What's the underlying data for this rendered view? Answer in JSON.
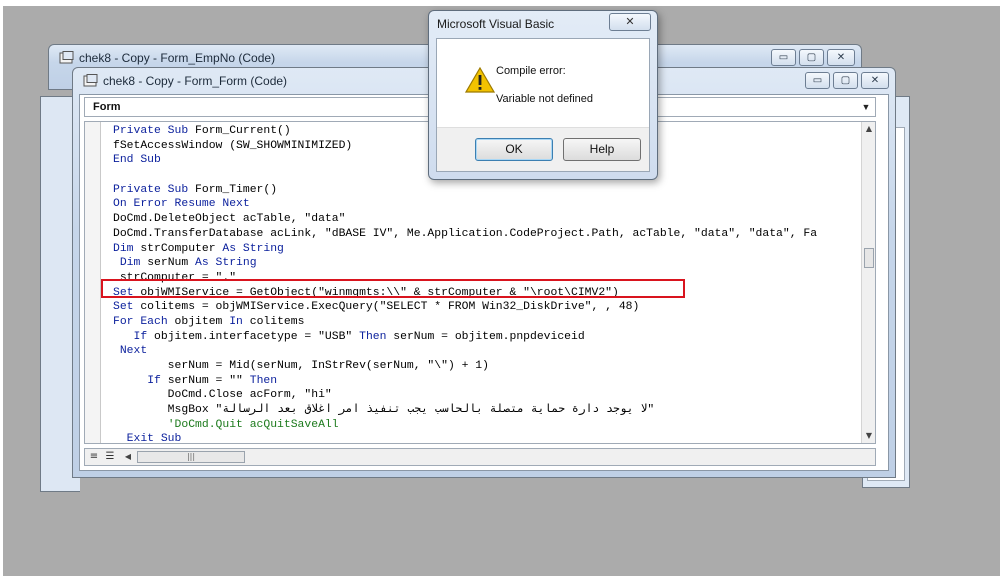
{
  "back_window": {
    "title": "chek8 - Copy - Form_EmpNo (Code)"
  },
  "main_window": {
    "title": "chek8 - Copy - Form_Form (Code)",
    "object_combo": "Form",
    "caption_buttons": {
      "minimize": "▭",
      "maximize": "▢",
      "close": "✕"
    }
  },
  "code_lines": [
    [
      {
        "t": "Private Sub ",
        "k": "kw"
      },
      {
        "t": "Form_Current()"
      }
    ],
    [
      {
        "t": "fSetAccessWindow (SW_SHOWMINIMIZED)"
      }
    ],
    [
      {
        "t": "End Sub",
        "k": "kw"
      }
    ],
    [
      {
        "t": ""
      }
    ],
    [
      {
        "t": "Private Sub ",
        "k": "kw"
      },
      {
        "t": "Form_Timer()"
      }
    ],
    [
      {
        "t": "On Error Resume Next",
        "k": "kw"
      }
    ],
    [
      {
        "t": "DoCmd.DeleteObject acTable, \"data\""
      }
    ],
    [
      {
        "t": "DoCmd.TransferDatabase acLink, \"dBASE IV\", Me.Application.CodeProject.Path, acTable, \"data\", \"data\", Fa"
      }
    ],
    [
      {
        "t": "Dim ",
        "k": "kw"
      },
      {
        "t": "strComputer "
      },
      {
        "t": "As String",
        "k": "kw"
      }
    ],
    [
      {
        "t": " Dim ",
        "k": "kw"
      },
      {
        "t": "serNum "
      },
      {
        "t": "As String",
        "k": "kw"
      }
    ],
    [
      {
        "t": " strComputer = \".\""
      }
    ],
    [
      {
        "t": "Set ",
        "k": "kw"
      },
      {
        "t": "objWMIService = GetObject(\"winmgmts:\\\\\" & strComputer & \"\\root\\CIMV2\")"
      }
    ],
    [
      {
        "t": "Set ",
        "k": "kw"
      },
      {
        "t": "colitems = objWMIService.ExecQuery(\"SELECT * FROM Win32_DiskDrive\", , 48)"
      }
    ],
    [
      {
        "t": "For Each ",
        "k": "kw"
      },
      {
        "t": "objitem "
      },
      {
        "t": "In ",
        "k": "kw"
      },
      {
        "t": "colitems"
      }
    ],
    [
      {
        "t": "   "
      },
      {
        "t": "If ",
        "k": "kw"
      },
      {
        "t": "objitem.interfacetype = \"USB\" "
      },
      {
        "t": "Then ",
        "k": "kw"
      },
      {
        "t": "serNum = objitem.pnpdeviceid"
      }
    ],
    [
      {
        "t": " "
      },
      {
        "t": "Next",
        "k": "kw"
      }
    ],
    [
      {
        "t": "        serNum = Mid(serNum, InStrRev(serNum, \"\\\") + 1)"
      }
    ],
    [
      {
        "t": "     "
      },
      {
        "t": "If ",
        "k": "kw"
      },
      {
        "t": "serNum = \"\" "
      },
      {
        "t": "Then",
        "k": "kw"
      }
    ],
    [
      {
        "t": "        DoCmd.Close acForm, \"hi\""
      }
    ],
    [
      {
        "t": "        MsgBox \"لا يوجد دارة حماية متصلة بالحاسب يجب تنفيذ امر اغلاق بعد الرسالة\""
      }
    ],
    [
      {
        "t": "        "
      },
      {
        "t": "'DoCmd.Quit acQuitSaveAll",
        "k": "cm"
      }
    ],
    [
      {
        "t": "  "
      },
      {
        "t": "Exit Sub",
        "k": "kw"
      }
    ]
  ],
  "dialog": {
    "title": "Microsoft Visual Basic",
    "close": "✕",
    "line1": "Compile error:",
    "line2": "Variable not defined",
    "ok_label": "OK",
    "help_label": "Help"
  },
  "colors": {
    "keyword": "#0a1f9c",
    "comment": "#1c7a1c",
    "highlight_box": "#d9141e",
    "warning": "#f2c200"
  },
  "icons": [
    "code-window-icon",
    "warning-icon",
    "scroll-up-icon",
    "scroll-down-icon",
    "procedure-view-icon",
    "full-module-view-icon"
  ]
}
